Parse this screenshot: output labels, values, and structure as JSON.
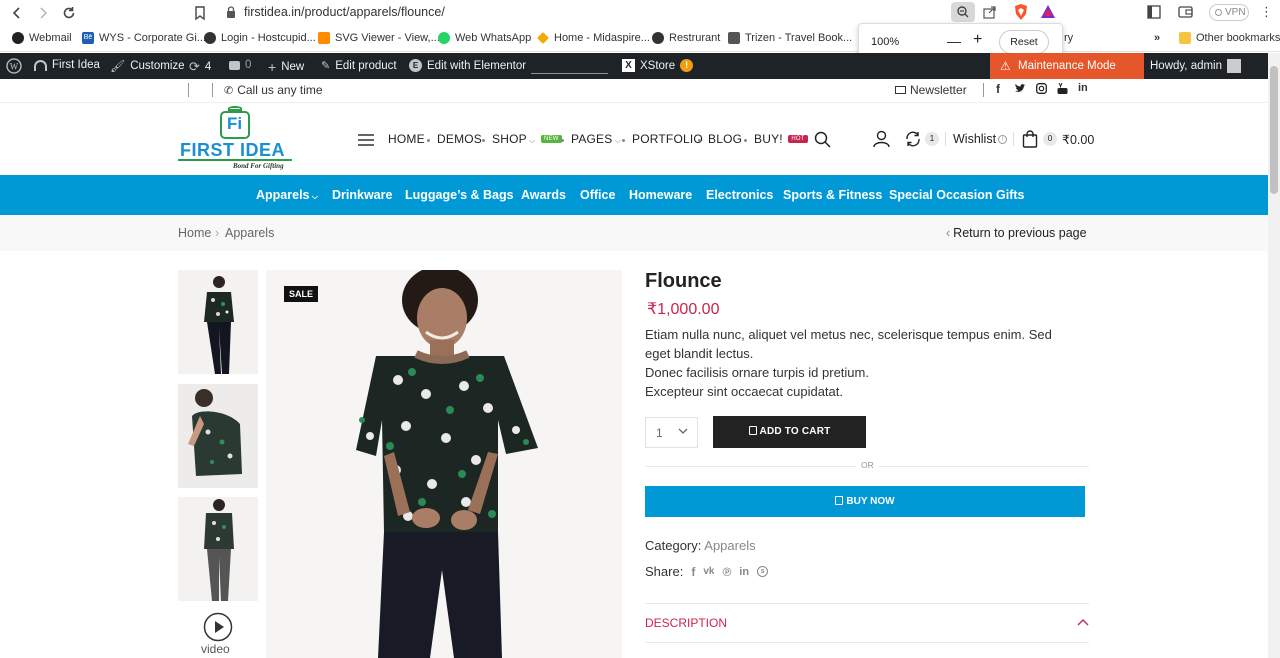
{
  "browser": {
    "url": "firstidea.in/product/apparels/flounce/",
    "vpn_label": "VPN"
  },
  "bookmarks": [
    {
      "label": "Webmail"
    },
    {
      "label": "WYS - Corporate Gi..."
    },
    {
      "label": "Login - Hostcupid..."
    },
    {
      "label": "SVG Viewer - View,..."
    },
    {
      "label": "Web WhatsApp"
    },
    {
      "label": "Home - Midaspire..."
    },
    {
      "label": "Restrurant"
    },
    {
      "label": "Trizen - Travel Book..."
    },
    {
      "label": "ry"
    },
    {
      "label": "Other bookmarks"
    }
  ],
  "zoom": {
    "level": "100%",
    "minus": "—",
    "plus": "+",
    "reset": "Reset"
  },
  "wpbar": {
    "site": "First Idea",
    "customize": "Customize",
    "updates": "4",
    "comments": "0",
    "new": "New",
    "edit_product": "Edit product",
    "elementor": "Edit with Elementor",
    "xstore": "XStore",
    "xstore_alert": "!",
    "maintenance": "Maintenance Mode Active",
    "howdy": "Howdy, admin"
  },
  "topinfo": {
    "call": "Call us any time",
    "newsletter": "Newsletter"
  },
  "header": {
    "logo_title": "FIRST IDEA",
    "logo_tagline": "Bond For Gifting",
    "logo_mark": "Fi",
    "menu": [
      {
        "label": "HOME"
      },
      {
        "label": "DEMOS"
      },
      {
        "label": "SHOP",
        "badge": "NEW"
      },
      {
        "label": "PAGES"
      },
      {
        "label": "PORTFOLIO"
      },
      {
        "label": "BLOG"
      },
      {
        "label": "BUY!",
        "badge": "HOT"
      }
    ],
    "compare_count": "1",
    "wishlist": "Wishlist",
    "cart_count": "0",
    "cart_total": "₹0.00"
  },
  "categories": [
    {
      "label": "Apparels"
    },
    {
      "label": "Drinkware"
    },
    {
      "label": "Luggage’s & Bags"
    },
    {
      "label": "Awards"
    },
    {
      "label": "Office"
    },
    {
      "label": "Homeware"
    },
    {
      "label": "Electronics"
    },
    {
      "label": "Sports & Fitness"
    },
    {
      "label": "Special Occasion Gifts"
    }
  ],
  "breadcrumb": {
    "home": "Home",
    "sep": "›",
    "current": "Apparels",
    "back": "Return to previous page"
  },
  "gallery": {
    "sale": "SALE",
    "video_label": "video"
  },
  "product": {
    "title": "Flounce",
    "price": "₹1,000.00",
    "description": [
      "Etiam nulla nunc, aliquet vel metus nec, scelerisque tempus enim. Sed",
      "eget blandit lectus.",
      "Donec facilisis ornare turpis id pretium.",
      "Excepteur sint occaecat cupidatat."
    ],
    "qty": "1",
    "add_to_cart": "ADD TO CART",
    "or": "OR",
    "buy_now": "BUY NOW",
    "category_label": "Category:",
    "category_value": "Apparels",
    "share_label": "Share:",
    "description_tab": "DESCRIPTION"
  },
  "colors": {
    "accent": "#0099d6",
    "price": "#c7254e",
    "maintenance": "#e5572a",
    "wpbar": "#1d2327"
  }
}
